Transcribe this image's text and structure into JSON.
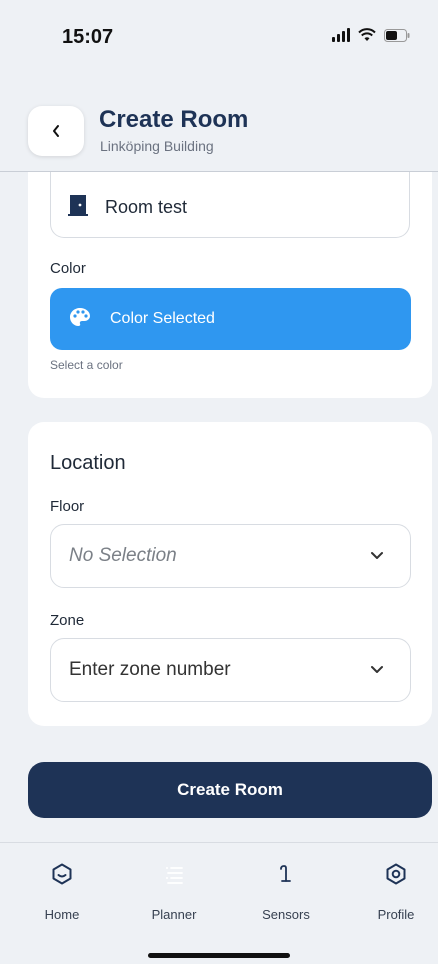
{
  "status_bar": {
    "time": "15:07"
  },
  "header": {
    "title": "Create Room",
    "subtitle": "Linköping Building",
    "back_icon": "chevron-left-icon"
  },
  "details": {
    "room_name_value": "Room test",
    "room_icon": "door-icon",
    "color_label": "Color",
    "color_button_label": "Color Selected",
    "color_button_icon": "palette-icon",
    "color_button_bg": "#2f97f0",
    "color_helper": "Select a color"
  },
  "location": {
    "title": "Location",
    "floor_label": "Floor",
    "floor_value": "No Selection",
    "zone_label": "Zone",
    "zone_value": "Enter zone number"
  },
  "actions": {
    "create_label": "Create Room",
    "create_bg": "#1e3356"
  },
  "tabbar": {
    "items": [
      {
        "label": "Home",
        "icon": "home-icon",
        "active": false
      },
      {
        "label": "Planner",
        "icon": "planner-icon",
        "active": true
      },
      {
        "label": "Sensors",
        "icon": "sensor-icon",
        "active": false
      },
      {
        "label": "Profile",
        "icon": "profile-icon",
        "active": false
      }
    ]
  }
}
